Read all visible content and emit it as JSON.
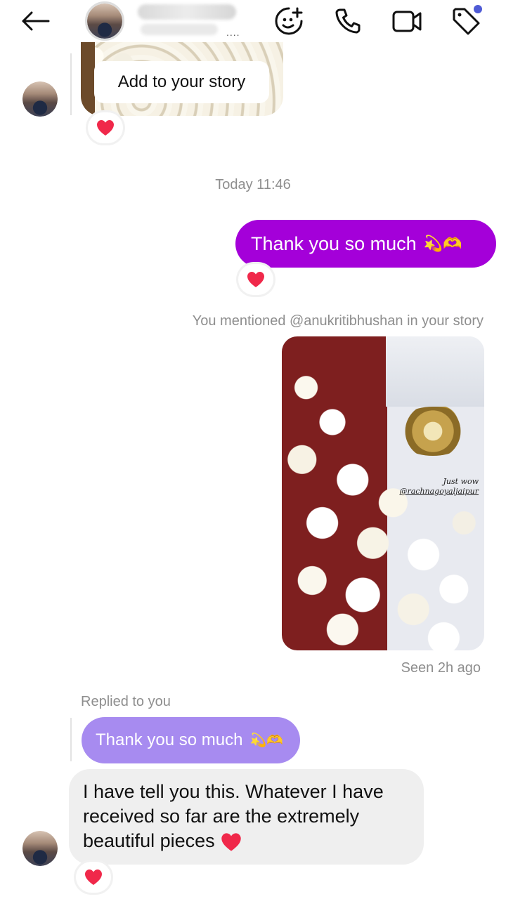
{
  "header": {
    "back_icon": "arrow-left-icon",
    "icons": [
      "sticker-add-icon",
      "phone-icon",
      "video-camera-icon",
      "tag-icon"
    ],
    "accent_dot_color": "#4f5bd5"
  },
  "messages": {
    "add_to_story_label": "Add to your story",
    "timestamp": "Today 11:46",
    "outgoing_text": "Thank you so much",
    "outgoing_emojis": "💫🫶",
    "mention_notice": "You mentioned @anukritibhushan in your story",
    "story_caption_line1": "Just wow",
    "story_caption_line2": "@rachnagoyaljaipur",
    "seen_status": "Seen 2h ago",
    "replied_label": "Replied to you",
    "reply_quote_text": "Thank you so much",
    "reply_quote_emojis": "💫🫶",
    "incoming_text": "I have tell you this. Whatever I have received so far are the extremely beautiful pieces",
    "reaction_emoji": "heart-icon"
  },
  "colors": {
    "outgoing_bubble": "#a400d9",
    "reply_bubble": "#a78bf0",
    "incoming_bubble": "#efefef",
    "meta_text": "#8e8e8e",
    "heart": "#f0284a"
  }
}
